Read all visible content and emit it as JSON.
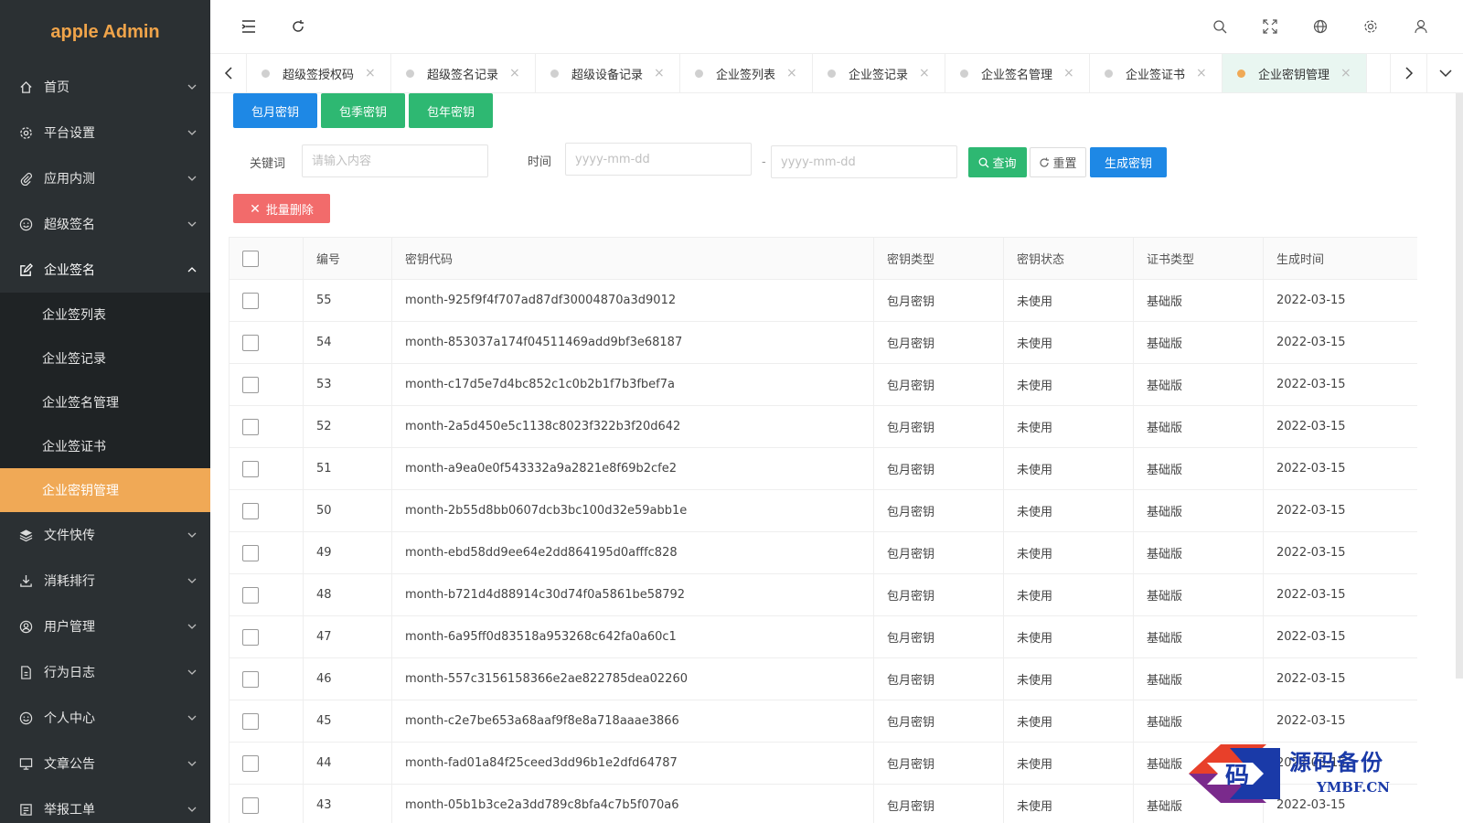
{
  "app": {
    "title": "apple Admin"
  },
  "sidebar": {
    "items": [
      {
        "label": "首页",
        "icon": "home-icon"
      },
      {
        "label": "平台设置",
        "icon": "gear-icon"
      },
      {
        "label": "应用内测",
        "icon": "paperclip-icon"
      },
      {
        "label": "超级签名",
        "icon": "smile-icon"
      },
      {
        "label": "企业签名",
        "icon": "edit-icon",
        "expanded": true,
        "children": [
          "企业签列表",
          "企业签记录",
          "企业签名管理",
          "企业签证书",
          "企业密钥管理"
        ],
        "active_child": "企业密钥管理"
      },
      {
        "label": "文件快传",
        "icon": "layers-icon"
      },
      {
        "label": "消耗排行",
        "icon": "download-icon"
      },
      {
        "label": "用户管理",
        "icon": "user-circle-icon"
      },
      {
        "label": "行为日志",
        "icon": "log-file-icon"
      },
      {
        "label": "个人中心",
        "icon": "face-icon"
      },
      {
        "label": "文章公告",
        "icon": "monitor-icon"
      },
      {
        "label": "举报工单",
        "icon": "report-icon"
      }
    ]
  },
  "header": {
    "left_icons": [
      "menu-fold-icon",
      "refresh-icon"
    ],
    "right_icons": [
      "search-icon",
      "fullscreen-icon",
      "globe-icon",
      "gear-icon",
      "user-icon"
    ]
  },
  "tabs": {
    "items": [
      "超级签授权码",
      "超级签名记录",
      "超级设备记录",
      "企业签列表",
      "企业签记录",
      "企业签名管理",
      "企业签证书",
      "企业密钥管理"
    ],
    "active": "企业密钥管理"
  },
  "actions": {
    "monthly": "包月密钥",
    "quarterly": "包季密钥",
    "yearly": "包年密钥"
  },
  "filter": {
    "keyword_label": "关键词",
    "keyword_placeholder": "请输入内容",
    "time_label": "时间",
    "date_start_placeholder": "yyyy-mm-dd",
    "date_sep": "-",
    "date_end_placeholder": "yyyy-mm-dd",
    "query": "查询",
    "reset": "重置",
    "generate": "生成密钥"
  },
  "batch_delete": "批量删除",
  "table": {
    "columns": [
      "编号",
      "密钥代码",
      "密钥类型",
      "密钥状态",
      "证书类型",
      "生成时间"
    ],
    "rows": [
      [
        "55",
        "month-925f9f4f707ad87df30004870a3d9012",
        "包月密钥",
        "未使用",
        "基础版",
        "2022-03-15"
      ],
      [
        "54",
        "month-853037a174f04511469add9bf3e68187",
        "包月密钥",
        "未使用",
        "基础版",
        "2022-03-15"
      ],
      [
        "53",
        "month-c17d5e7d4bc852c1c0b2b1f7b3fbef7a",
        "包月密钥",
        "未使用",
        "基础版",
        "2022-03-15"
      ],
      [
        "52",
        "month-2a5d450e5c1138c8023f322b3f20d642",
        "包月密钥",
        "未使用",
        "基础版",
        "2022-03-15"
      ],
      [
        "51",
        "month-a9ea0e0f543332a9a2821e8f69b2cfe2",
        "包月密钥",
        "未使用",
        "基础版",
        "2022-03-15"
      ],
      [
        "50",
        "month-2b55d8bb0607dcb3bc100d32e59abb1e",
        "包月密钥",
        "未使用",
        "基础版",
        "2022-03-15"
      ],
      [
        "49",
        "month-ebd58dd9ee64e2dd864195d0afffc828",
        "包月密钥",
        "未使用",
        "基础版",
        "2022-03-15"
      ],
      [
        "48",
        "month-b721d4d88914c30d74f0a5861be58792",
        "包月密钥",
        "未使用",
        "基础版",
        "2022-03-15"
      ],
      [
        "47",
        "month-6a95ff0d83518a953268c642fa0a60c1",
        "包月密钥",
        "未使用",
        "基础版",
        "2022-03-15"
      ],
      [
        "46",
        "month-557c3156158366e2ae822785dea02260",
        "包月密钥",
        "未使用",
        "基础版",
        "2022-03-15"
      ],
      [
        "45",
        "month-c2e7be653a68aaf9f8e8a718aaae3866",
        "包月密钥",
        "未使用",
        "基础版",
        "2022-03-15"
      ],
      [
        "44",
        "month-fad01a84f25ceed3dd96b1e2dfd64787",
        "包月密钥",
        "未使用",
        "基础版",
        "2022-03-15"
      ],
      [
        "43",
        "month-05b1b3ce2a3dd789c8bfa4c7b5f070a6",
        "包月密钥",
        "未使用",
        "基础版",
        "2022-03-15"
      ]
    ]
  },
  "watermark": {
    "text": "源码备份",
    "site": "YMBF.CN",
    "glyph": "码"
  },
  "colors": {
    "sidebar_bg": "#2b3033",
    "accent": "#f0a956",
    "blue": "#1e88e5",
    "green": "#2eb872",
    "red": "#f26b6b"
  }
}
